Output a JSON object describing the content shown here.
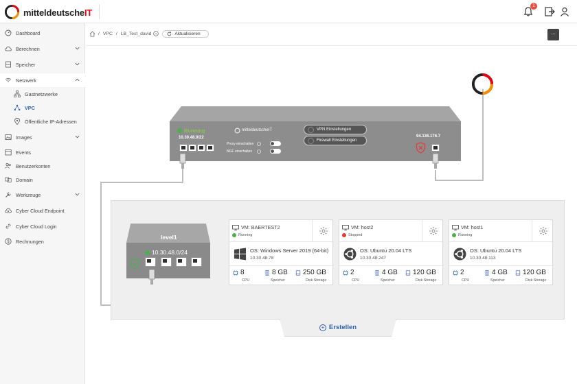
{
  "header": {
    "brand_main": "mitteldeutsche",
    "brand_it": "IT",
    "notification_count": "1",
    "colors": {
      "brand_red": "#e30613",
      "brand_orange": "#f39200",
      "link_blue": "#2a5fb4"
    }
  },
  "sidebar": {
    "items": [
      {
        "label": "Dashboard",
        "icon": "dashboard-icon"
      },
      {
        "label": "Berechnen",
        "icon": "cloud-icon"
      },
      {
        "label": "Speicher",
        "icon": "storage-icon"
      },
      {
        "label": "Netzwerk",
        "icon": "wifi-icon"
      },
      {
        "label": "Gastnetzwerke",
        "icon": "sitemap-icon"
      },
      {
        "label": "VPC",
        "icon": "network-icon"
      },
      {
        "label": "Öffentliche IP-Adressen",
        "icon": "location-icon"
      },
      {
        "label": "Images",
        "icon": "image-icon"
      },
      {
        "label": "Events",
        "icon": "calendar-icon"
      },
      {
        "label": "Benutzerkonten",
        "icon": "users-icon"
      },
      {
        "label": "Domain",
        "icon": "domain-icon"
      },
      {
        "label": "Werkzeuge",
        "icon": "tools-icon"
      },
      {
        "label": "Cyber Cloud Endpoint",
        "icon": "endpoint-icon"
      },
      {
        "label": "Cyber Cloud Login",
        "icon": "link-icon"
      },
      {
        "label": "Rechnungen",
        "icon": "dollar-icon"
      }
    ]
  },
  "breadcrumb": {
    "vpc": "VPC",
    "current": "LB_Test_david",
    "refresh_label": "Aktualisieren",
    "more_label": "..."
  },
  "router": {
    "status": "Running",
    "ip": "10.30.48.0/22",
    "brand": "mitteldeutscheIT",
    "proxy_label": "Proxy einschalten",
    "ngf_label": "NGF einschalten",
    "vpn_button": "VPN Einstellungen",
    "firewall_button": "Firewall Einstellungen",
    "wan_ip": "94.136.176.7"
  },
  "switch": {
    "name": "level1",
    "ip": "10.30.48.0/24"
  },
  "vms": [
    {
      "name": "VM: BAERTEST2",
      "status": "Running",
      "status_color": "#4caf50",
      "os": "OS: Windows Server 2019 (64-bit)",
      "ip": "10.30.48.78",
      "os_icon": "windows-icon",
      "cpu": "8",
      "ram": "8 GB",
      "disk": "250 GB"
    },
    {
      "name": "VM: host2",
      "status": "Stopped",
      "status_color": "#e53935",
      "os": "OS: Ubuntu 20.04 LTS",
      "ip": "10.30.48.247",
      "os_icon": "ubuntu-icon",
      "cpu": "2",
      "ram": "4 GB",
      "disk": "120 GB"
    },
    {
      "name": "VM: host1",
      "status": "Running",
      "status_color": "#4caf50",
      "os": "OS: Ubuntu 20.04 LTS",
      "ip": "10.30.48.113",
      "os_icon": "ubuntu-icon",
      "cpu": "2",
      "ram": "4 GB",
      "disk": "120 GB"
    }
  ],
  "spec_labels": {
    "cpu": "CPU",
    "ram": "Speicher",
    "disk": "Disk Storage"
  },
  "create_button": "Erstellen"
}
